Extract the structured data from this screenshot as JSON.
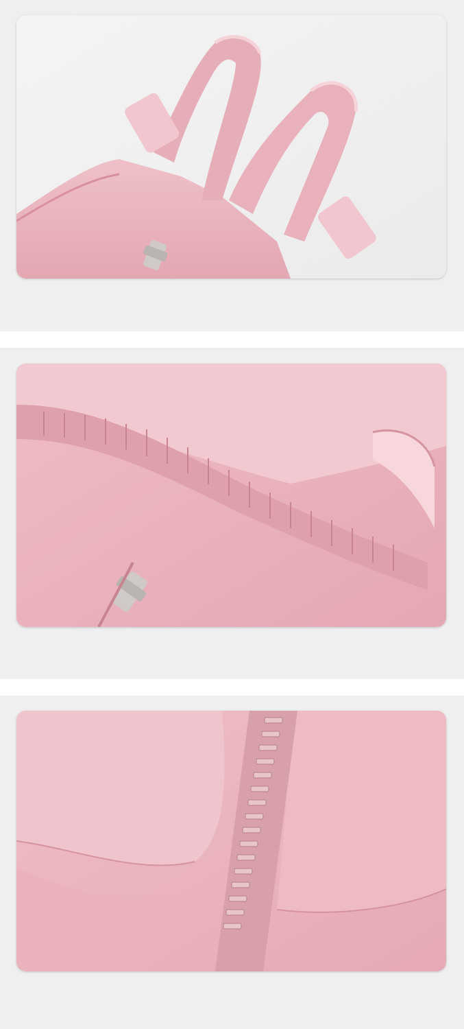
{
  "images": [
    {
      "id": "closeup-straps",
      "subject": "pink-snowsuit-adjustable-straps"
    },
    {
      "id": "closeup-waist",
      "subject": "pink-snowsuit-elastic-waist"
    },
    {
      "id": "closeup-zipper",
      "subject": "pink-snowsuit-leg-zipper"
    }
  ],
  "colors": {
    "fabric_main": "#eab3bd",
    "fabric_shadow": "#d592a0",
    "fabric_highlight": "#f6d3d9",
    "zipper_metal": "#c9c4c2",
    "panel_bg": "#efefef"
  }
}
